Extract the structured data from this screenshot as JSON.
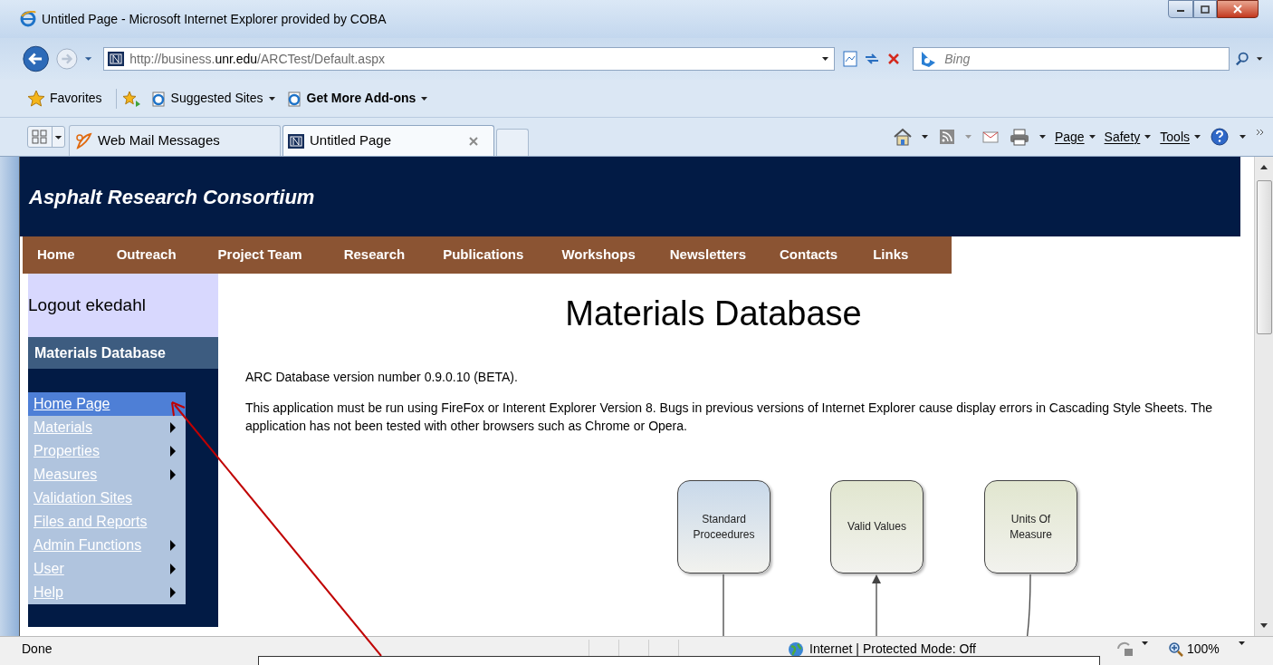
{
  "window": {
    "title": "Untitled Page - Microsoft Internet Explorer provided by COBA"
  },
  "address": {
    "url": "http://business.**unr.edu**/ARCTest/Default.aspx"
  },
  "search": {
    "placeholder": "Bing"
  },
  "favorites_bar": [
    {
      "label": "Favorites",
      "kind": "favorites"
    },
    {
      "label": "Suggested Sites",
      "kind": "menu"
    },
    {
      "label": "Get More Add-ons",
      "kind": "menu"
    }
  ],
  "tabs": [
    {
      "label": "Web Mail Messages",
      "selected": false
    },
    {
      "label": "Untitled Page",
      "selected": true
    }
  ],
  "command_bar": [
    "Page",
    "Safety",
    "Tools"
  ],
  "page": {
    "site_title": "Asphalt Research Consortium",
    "nav": [
      "Home",
      "Outreach",
      "Project Team",
      "Research",
      "Publications",
      "Workshops",
      "Newsletters",
      "Contacts",
      "Links"
    ],
    "logout": "Logout ekedahl",
    "sidebar_heading": "Materials Database",
    "menu": [
      {
        "label": "Home Page",
        "submenu": false,
        "selected": true
      },
      {
        "label": "Materials",
        "submenu": true,
        "selected": false
      },
      {
        "label": "Properties",
        "submenu": true,
        "selected": false
      },
      {
        "label": "Measures",
        "submenu": true,
        "selected": false
      },
      {
        "label": "Validation Sites",
        "submenu": false,
        "selected": false
      },
      {
        "label": "Files and Reports",
        "submenu": false,
        "selected": false
      },
      {
        "label": "Admin Functions",
        "submenu": true,
        "selected": false
      },
      {
        "label": "User",
        "submenu": true,
        "selected": false
      },
      {
        "label": "Help",
        "submenu": true,
        "selected": false
      }
    ],
    "heading": "Materials Database",
    "paragraphs": [
      "ARC Database version number 0.9.0.10 (BETA).",
      "This application must be run using FireFox or Interent Explorer Version 8. Bugs in previous versions of Internet Explorer cause display errors in Cascading Style Sheets. The application has not been tested with other browsers such as Chrome or Opera."
    ],
    "diagram": [
      {
        "label": "Standard Proceedures",
        "color": "#c9d9ea",
        "kind": "line"
      },
      {
        "label": "Valid Values",
        "color": "#e1e6cf",
        "kind": "arrow"
      },
      {
        "label": "Units Of Measure",
        "color": "#e1e6cf",
        "kind": "curve"
      }
    ]
  },
  "status_bar": {
    "text": "Done",
    "zone": "Internet | Protected Mode: Off",
    "zoom": "100%"
  }
}
